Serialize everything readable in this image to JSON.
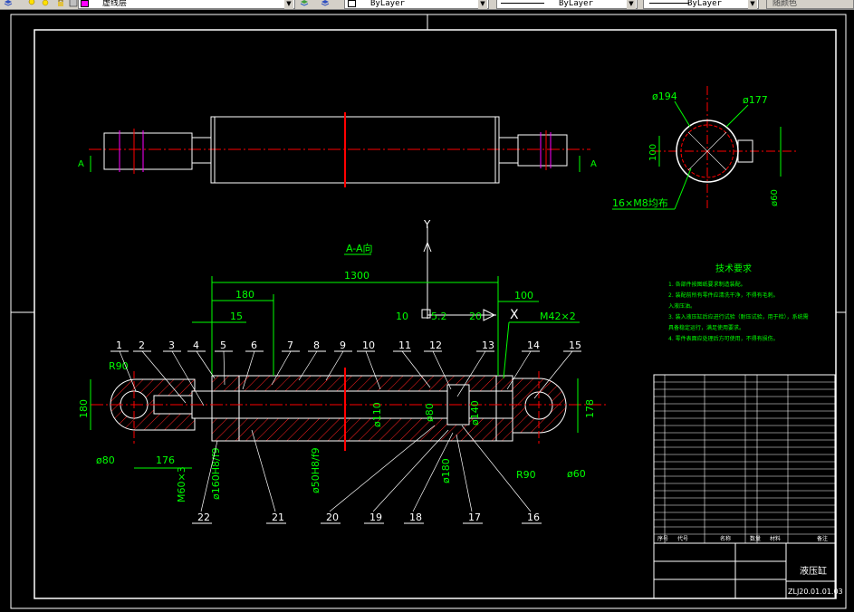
{
  "toolbar": {
    "layer_name": "虚线层",
    "color_control": "ByLayer",
    "linetype_control": "ByLayer",
    "lineweight_control": "ByLayer",
    "plotstyle_control": "随颜色",
    "icons": [
      "layer-manager-icon",
      "bulb-icon",
      "sun-icon",
      "lock-icon",
      "color-swatch-icon",
      "make-current-icon",
      "layer-previous-icon"
    ],
    "colors": {
      "bg": "#d4d0c8",
      "swatch_magenta": "#ff00ff"
    }
  },
  "drawing": {
    "colors": {
      "background": "#000000",
      "frame": "#ffffff",
      "dimension": "#00ff00",
      "centerline": "#ff0000",
      "hatch": "#ff0000",
      "text": "#ffffff",
      "magenta": "#ff00ff"
    },
    "section_label": "A-A向",
    "view_markers": {
      "left": "A",
      "right": "A"
    },
    "axis_y": "Y",
    "axis_x": "X",
    "dims": {
      "total_length": "1300",
      "d180": "180",
      "d15": "15",
      "d10": "10",
      "d5_2": "5.2",
      "d20": "20",
      "d100": "100",
      "thread": "M42×2",
      "r90_left": "R90",
      "r90_right": "R90",
      "h180": "180",
      "h178": "178",
      "dia80": "ø80",
      "d176": "176",
      "dia60": "ø60",
      "dia110": "ø110",
      "dia80b": "ø80",
      "dia140": "ø140",
      "dia180": "ø180",
      "fit1": "ø160H8/f9",
      "fit2": "ø50H8/f9",
      "m60": "M60×3"
    },
    "end_view": {
      "dia194": "ø194",
      "dia177": "ø177",
      "d100": "100",
      "dia60": "ø60",
      "bolts": "16×M8均布"
    },
    "part_numbers_top": [
      "1",
      "2",
      "3",
      "4",
      "5",
      "6",
      "7",
      "8",
      "9",
      "10",
      "11",
      "12",
      "13",
      "14",
      "15"
    ],
    "part_numbers_bottom": [
      "22",
      "21",
      "20",
      "19",
      "18",
      "17",
      "16"
    ],
    "tech_title": "技术要求",
    "tech_lines": [
      "1. 各部件按图纸要求制造装配。",
      "2. 装配前所有零件应清洗干净，不得有毛刺。",
      "入液压油。",
      "3. 装入液压缸后应进行试验（耐压试验，用于检），系统需",
      "具备稳定运行，满足使用要求。",
      "4. 零件表面应处理后方可使用，不得有损伤。"
    ],
    "title_block": {
      "name": "液压缸",
      "code": "ZLJ20.01.01.03",
      "labels": [
        "序号",
        "代号",
        "名称",
        "数量",
        "材料",
        "备注"
      ]
    }
  }
}
